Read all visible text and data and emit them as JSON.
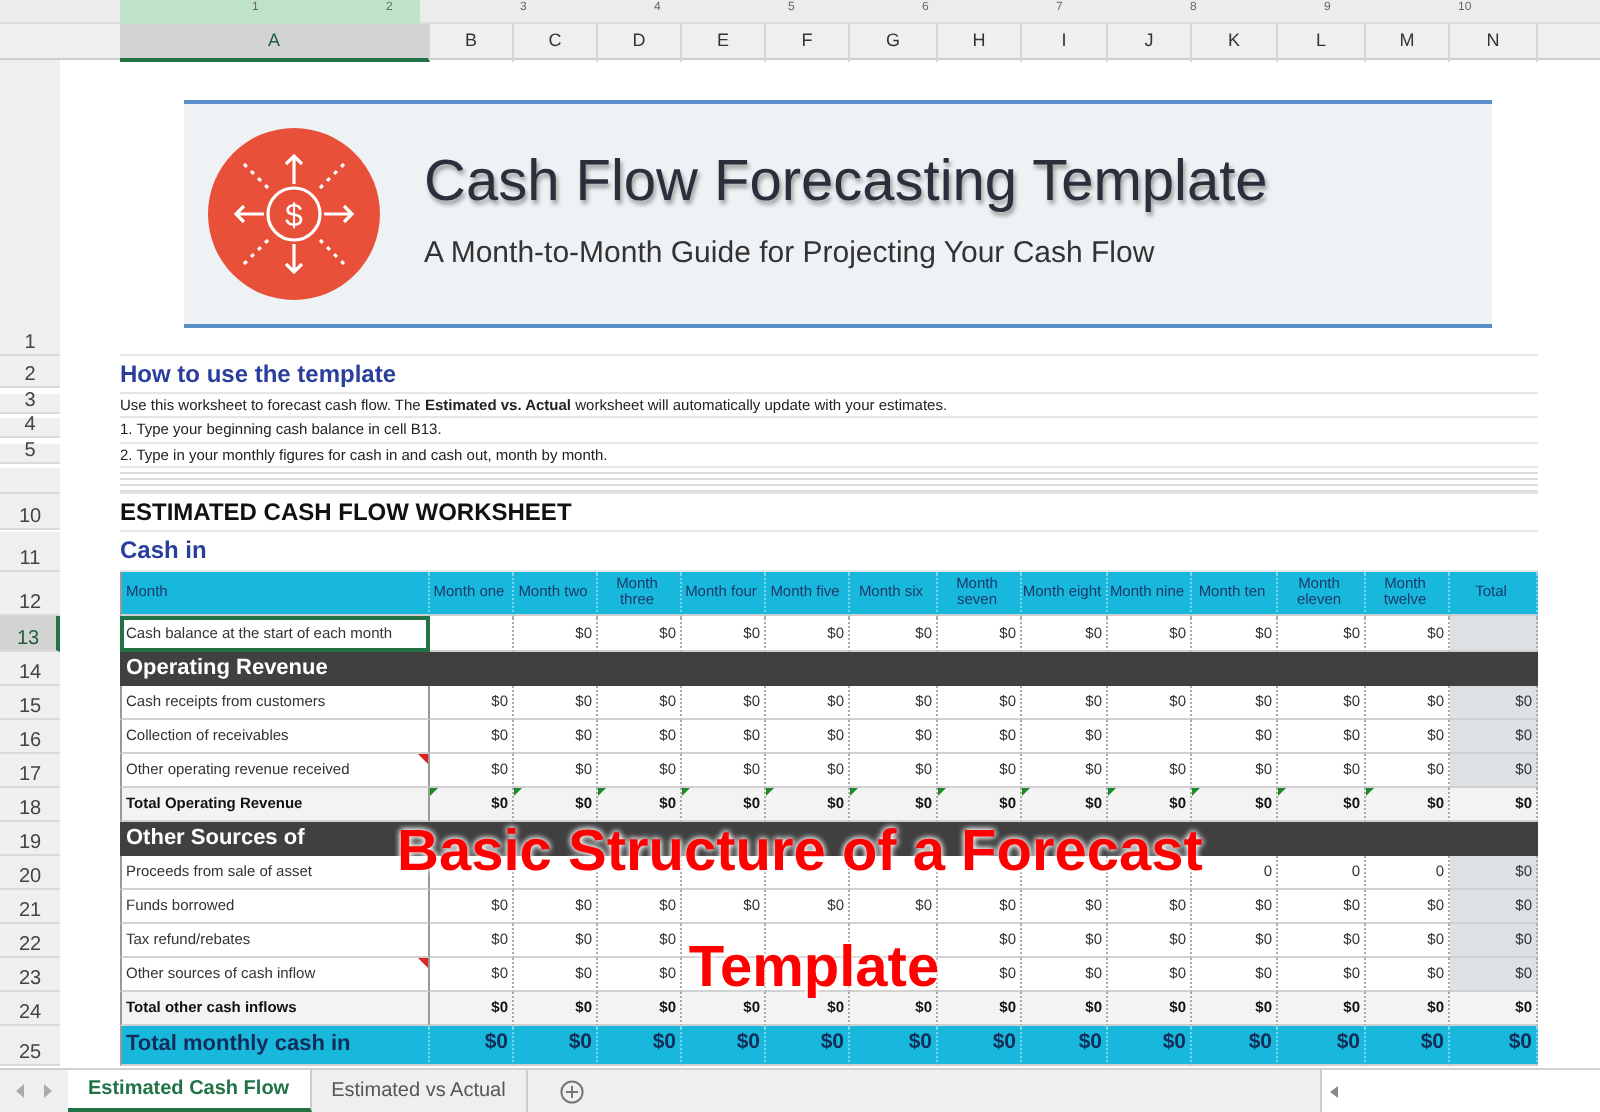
{
  "ruler": {
    "ticks": [
      "1",
      "2",
      "3",
      "4",
      "5",
      "6",
      "7",
      "8",
      "9",
      "10"
    ]
  },
  "column_headers": [
    {
      "label": "A",
      "selected": true
    },
    {
      "label": "B",
      "selected": false
    },
    {
      "label": "C",
      "selected": false
    },
    {
      "label": "D",
      "selected": false
    },
    {
      "label": "E",
      "selected": false
    },
    {
      "label": "F",
      "selected": false
    },
    {
      "label": "G",
      "selected": false
    },
    {
      "label": "H",
      "selected": false
    },
    {
      "label": "I",
      "selected": false
    },
    {
      "label": "J",
      "selected": false
    },
    {
      "label": "K",
      "selected": false
    },
    {
      "label": "L",
      "selected": false
    },
    {
      "label": "M",
      "selected": false
    },
    {
      "label": "N",
      "selected": false
    }
  ],
  "banner": {
    "logo_symbol": "$",
    "title": "Cash Flow Forecasting Template",
    "subtitle": "A Month-to-Month Guide for Projecting Your Cash Flow"
  },
  "intro_rows": [
    {
      "number": "1",
      "kind": "blank"
    },
    {
      "number": "2",
      "kind": "heading",
      "text": "How to use the template"
    },
    {
      "number": "3",
      "kind": "line",
      "text": "Use this worksheet to forecast cash flow. The **Estimated vs. Actual** worksheet will automatically update with your estimates."
    },
    {
      "number": "4",
      "kind": "line",
      "text": "1. Type your beginning cash balance in cell B13."
    },
    {
      "number": "5",
      "kind": "line",
      "text": "2. Type in your monthly figures for cash in and cash out, month by month."
    },
    {
      "kind": "collapsed"
    },
    {
      "number": "10",
      "kind": "title",
      "text": "ESTIMATED CASH FLOW WORKSHEET"
    },
    {
      "number": "11",
      "kind": "heading",
      "text": "Cash in"
    }
  ],
  "table": {
    "rows": [
      {
        "number": "12",
        "kind": "header",
        "selected": false,
        "label": "Month",
        "values": [
          {
            "text": "Month one"
          },
          {
            "text": "Month two"
          },
          {
            "text": "Month three"
          },
          {
            "text": "Month four"
          },
          {
            "text": "Month five"
          },
          {
            "text": "Month six"
          },
          {
            "text": "Month seven"
          },
          {
            "text": "Month eight"
          },
          {
            "text": "Month nine"
          },
          {
            "text": "Month ten"
          },
          {
            "text": "Month eleven"
          },
          {
            "text": "Month twelve"
          },
          {
            "text": "Total"
          }
        ]
      },
      {
        "number": "13",
        "kind": "data",
        "selected": true,
        "label": "Cash balance at the start of each month",
        "values": [
          {
            "blank": true
          },
          {
            "text": "$0"
          },
          {
            "text": "$0"
          },
          {
            "text": "$0"
          },
          {
            "text": "$0"
          },
          {
            "text": "$0"
          },
          {
            "text": "$0"
          },
          {
            "text": "$0"
          },
          {
            "text": "$0"
          },
          {
            "text": "$0"
          },
          {
            "text": "$0"
          },
          {
            "text": "$0"
          },
          {
            "blank": true
          }
        ]
      },
      {
        "number": "14",
        "kind": "section",
        "selected": false,
        "label": "Operating Revenue"
      },
      {
        "number": "15",
        "kind": "data",
        "selected": false,
        "label": "Cash receipts from customers",
        "values": [
          {
            "text": "$0"
          },
          {
            "text": "$0"
          },
          {
            "text": "$0"
          },
          {
            "text": "$0"
          },
          {
            "text": "$0"
          },
          {
            "text": "$0"
          },
          {
            "text": "$0"
          },
          {
            "text": "$0"
          },
          {
            "text": "$0"
          },
          {
            "text": "$0"
          },
          {
            "text": "$0"
          },
          {
            "text": "$0"
          },
          {
            "text": "$0"
          }
        ]
      },
      {
        "number": "16",
        "kind": "data",
        "selected": false,
        "label": "Collection of receivables",
        "values": [
          {
            "text": "$0"
          },
          {
            "text": "$0"
          },
          {
            "text": "$0"
          },
          {
            "text": "$0"
          },
          {
            "text": "$0"
          },
          {
            "text": "$0"
          },
          {
            "text": "$0"
          },
          {
            "text": "$0"
          },
          {
            "blank": true
          },
          {
            "text": "$0"
          },
          {
            "text": "$0"
          },
          {
            "text": "$0"
          },
          {
            "text": "$0"
          }
        ]
      },
      {
        "number": "17",
        "kind": "data",
        "selected": false,
        "comment": true,
        "label": "Other operating revenue received",
        "values": [
          {
            "text": "$0"
          },
          {
            "text": "$0"
          },
          {
            "text": "$0"
          },
          {
            "text": "$0"
          },
          {
            "text": "$0"
          },
          {
            "text": "$0"
          },
          {
            "text": "$0"
          },
          {
            "text": "$0"
          },
          {
            "text": "$0"
          },
          {
            "text": "$0"
          },
          {
            "text": "$0"
          },
          {
            "text": "$0"
          },
          {
            "text": "$0"
          }
        ]
      },
      {
        "number": "18",
        "kind": "total",
        "selected": false,
        "flags": true,
        "label": "Total Operating Revenue",
        "values": [
          {
            "text": "$0"
          },
          {
            "text": "$0"
          },
          {
            "text": "$0"
          },
          {
            "text": "$0"
          },
          {
            "text": "$0"
          },
          {
            "text": "$0"
          },
          {
            "text": "$0"
          },
          {
            "text": "$0"
          },
          {
            "text": "$0"
          },
          {
            "text": "$0"
          },
          {
            "text": "$0"
          },
          {
            "text": "$0"
          },
          {
            "text": "$0"
          }
        ]
      },
      {
        "number": "19",
        "kind": "section",
        "selected": false,
        "label": "Other Sources of"
      },
      {
        "number": "20",
        "kind": "data",
        "selected": false,
        "label": "Proceeds from sale of asset",
        "values": [
          {
            "blank": true
          },
          {
            "blank": true
          },
          {
            "blank": true
          },
          {
            "blank": true
          },
          {
            "blank": true
          },
          {
            "blank": true
          },
          {
            "blank": true
          },
          {
            "blank": true
          },
          {
            "blank": true
          },
          {
            "text": "0"
          },
          {
            "text": "0"
          },
          {
            "text": "0"
          },
          {
            "text": "$0"
          }
        ]
      },
      {
        "number": "21",
        "kind": "data",
        "selected": false,
        "label": "Funds borrowed",
        "values": [
          {
            "text": "$0"
          },
          {
            "text": "$0"
          },
          {
            "text": "$0"
          },
          {
            "text": "$0"
          },
          {
            "text": "$0"
          },
          {
            "text": "$0"
          },
          {
            "text": "$0"
          },
          {
            "text": "$0"
          },
          {
            "text": "$0"
          },
          {
            "text": "$0"
          },
          {
            "text": "$0"
          },
          {
            "text": "$0"
          },
          {
            "text": "$0"
          }
        ]
      },
      {
        "number": "22",
        "kind": "data",
        "selected": false,
        "label": "Tax refund/rebates",
        "values": [
          {
            "text": "$0"
          },
          {
            "text": "$0"
          },
          {
            "text": "$0"
          },
          {
            "blank": true
          },
          {
            "blank": true
          },
          {
            "blank": true
          },
          {
            "text": "$0"
          },
          {
            "text": "$0"
          },
          {
            "text": "$0"
          },
          {
            "text": "$0"
          },
          {
            "text": "$0"
          },
          {
            "text": "$0"
          },
          {
            "text": "$0"
          }
        ]
      },
      {
        "number": "23",
        "kind": "data",
        "selected": false,
        "comment": true,
        "label": "Other sources of cash inflow",
        "values": [
          {
            "text": "$0"
          },
          {
            "text": "$0"
          },
          {
            "text": "$0"
          },
          {
            "blank": true
          },
          {
            "blank": true
          },
          {
            "blank": true
          },
          {
            "text": "$0"
          },
          {
            "text": "$0"
          },
          {
            "text": "$0"
          },
          {
            "text": "$0"
          },
          {
            "text": "$0"
          },
          {
            "text": "$0"
          },
          {
            "text": "$0"
          }
        ]
      },
      {
        "number": "24",
        "kind": "total",
        "selected": false,
        "label": "Total other cash inflows",
        "values": [
          {
            "text": "$0"
          },
          {
            "text": "$0"
          },
          {
            "text": "$0"
          },
          {
            "text": "$0"
          },
          {
            "text": "$0"
          },
          {
            "text": "$0"
          },
          {
            "text": "$0"
          },
          {
            "text": "$0"
          },
          {
            "text": "$0"
          },
          {
            "text": "$0"
          },
          {
            "text": "$0"
          },
          {
            "text": "$0"
          },
          {
            "text": "$0"
          }
        ]
      },
      {
        "number": "25",
        "kind": "grand",
        "selected": false,
        "label": "Total monthly cash in",
        "values": [
          {
            "text": "$0"
          },
          {
            "text": "$0"
          },
          {
            "text": "$0"
          },
          {
            "text": "$0"
          },
          {
            "text": "$0"
          },
          {
            "text": "$0"
          },
          {
            "text": "$0"
          },
          {
            "text": "$0"
          },
          {
            "text": "$0"
          },
          {
            "text": "$0"
          },
          {
            "text": "$0"
          },
          {
            "text": "$0"
          },
          {
            "text": "$0"
          }
        ]
      }
    ]
  },
  "caption": {
    "lines": [
      "Basic Structure of a Forecast",
      "Template"
    ]
  },
  "sheet_tabs": [
    {
      "label": "Estimated Cash Flow",
      "selected": true
    },
    {
      "label": "Estimated vs Actual",
      "selected": false
    }
  ]
}
